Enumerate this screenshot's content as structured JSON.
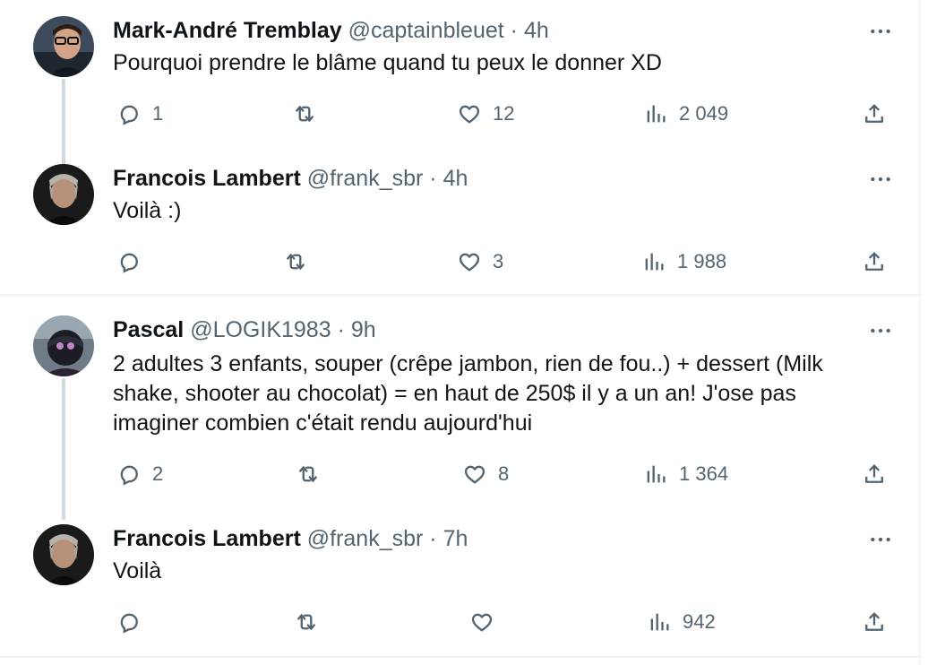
{
  "tweets": [
    {
      "name": "Mark-André Tremblay",
      "handle": "@captainbleuet",
      "dot": "·",
      "time": "4h",
      "text": [
        "Pourquoi prendre le blâme quand tu peux le donner XD"
      ],
      "replies": "1",
      "retweets": "",
      "likes": "12",
      "views": "2 049"
    },
    {
      "name": "Francois Lambert",
      "handle": "@frank_sbr",
      "dot": "·",
      "time": "4h",
      "text": [
        "Voilà :)"
      ],
      "replies": "",
      "retweets": "",
      "likes": "3",
      "views": "1 988"
    },
    {
      "name": "Pascal",
      "handle": "@LOGIK1983",
      "dot": "·",
      "time": "9h",
      "text": [
        "2 adultes 3 enfants, souper (crêpe jambon, rien de fou..) + dessert (Milk",
        "shake, shooter au chocolat) = en haut de 250$ il y a un an! J'ose pas",
        "imaginer combien c'était rendu aujourd'hui"
      ],
      "replies": "2",
      "retweets": "",
      "likes": "8",
      "views": "1 364"
    },
    {
      "name": "Francois Lambert",
      "handle": "@frank_sbr",
      "dot": "·",
      "time": "7h",
      "text": [
        "Voilà"
      ],
      "replies": "",
      "retweets": "",
      "likes": "",
      "views": "942"
    }
  ],
  "colors": {
    "text": "#0f1419",
    "secondary": "#536471",
    "thread_line": "#cfd9de",
    "divider": "#eff3f4"
  },
  "icons": [
    "reply-icon",
    "retweet-icon",
    "like-icon",
    "views-icon",
    "share-icon",
    "more-icon"
  ]
}
